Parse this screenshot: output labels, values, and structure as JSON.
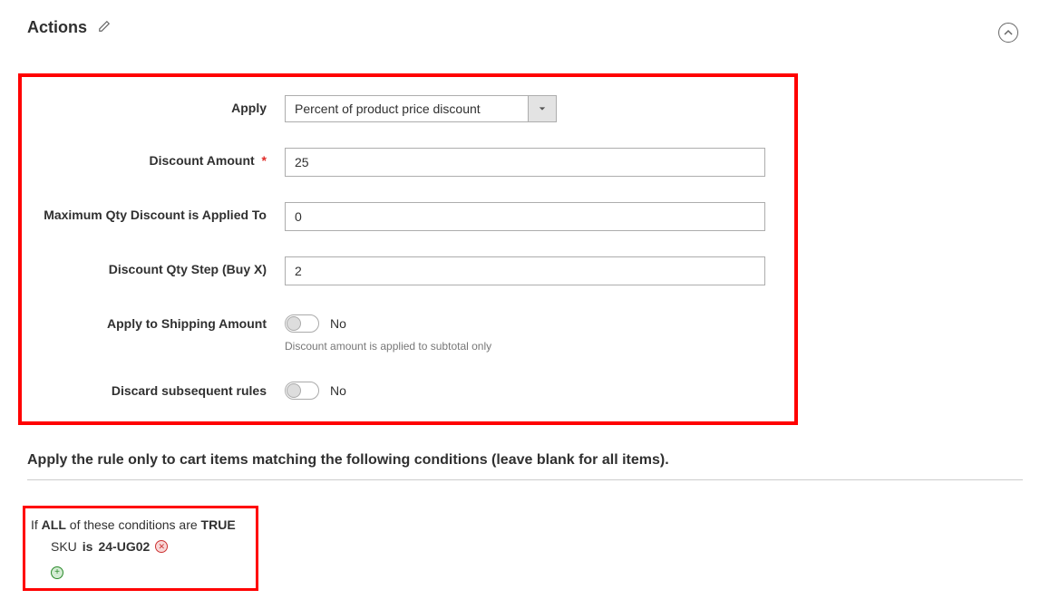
{
  "section": {
    "title": "Actions"
  },
  "fields": {
    "apply": {
      "label": "Apply",
      "value": "Percent of product price discount"
    },
    "discount_amount": {
      "label": "Discount Amount",
      "value": "25",
      "required": true
    },
    "max_qty": {
      "label": "Maximum Qty Discount is Applied To",
      "value": "0"
    },
    "qty_step": {
      "label": "Discount Qty Step (Buy X)",
      "value": "2"
    },
    "apply_shipping": {
      "label": "Apply to Shipping Amount",
      "value": "No",
      "hint": "Discount amount is applied to subtotal only"
    },
    "discard_rules": {
      "label": "Discard subsequent rules",
      "value": "No"
    }
  },
  "conditions": {
    "heading": "Apply the rule only to cart items matching the following conditions (leave blank for all items).",
    "root_prefix": "If ",
    "root_aggregator": "ALL",
    "root_mid": "  of these conditions are ",
    "root_value": "TRUE",
    "item": {
      "attribute": "SKU",
      "operator": "is",
      "value": "24-UG02"
    }
  }
}
